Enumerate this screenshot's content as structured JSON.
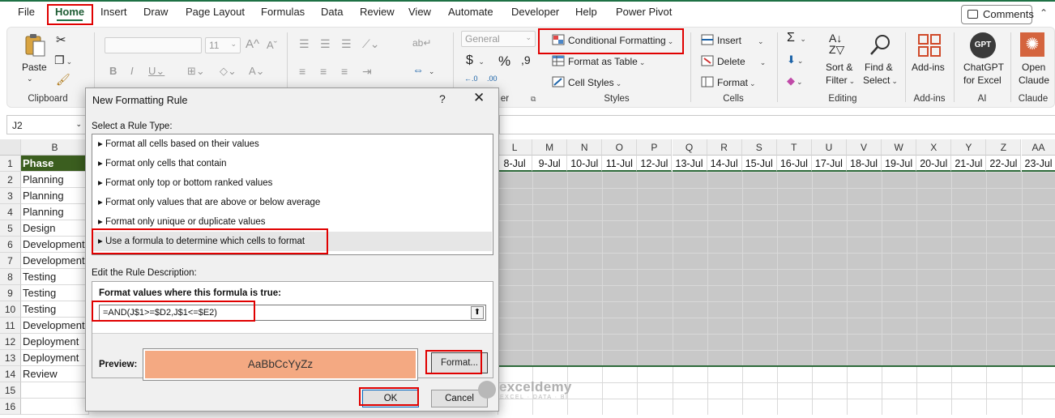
{
  "menu": {
    "tabs": [
      "File",
      "Home",
      "Insert",
      "Draw",
      "Page Layout",
      "Formulas",
      "Data",
      "Review",
      "View",
      "Automate",
      "Developer",
      "Help",
      "Power Pivot"
    ],
    "active": "Home",
    "comments": "Comments"
  },
  "ribbon": {
    "clipboard": {
      "paste": "Paste",
      "label": "Clipboard"
    },
    "font": {
      "size": "11"
    },
    "number": {
      "format": "General",
      "label_tail": "er"
    },
    "styles": {
      "conditional_formatting": "Conditional Formatting",
      "format_as_table": "Format as Table",
      "cell_styles": "Cell Styles",
      "label": "Styles"
    },
    "cells": {
      "insert": "Insert",
      "delete": "Delete",
      "format": "Format",
      "label": "Cells"
    },
    "editing": {
      "sort_filter_1": "Sort &",
      "sort_filter_2": "Filter",
      "find_select_1": "Find &",
      "find_select_2": "Select",
      "label": "Editing"
    },
    "addins": {
      "button": "Add-ins",
      "label": "Add-ins"
    },
    "ai": {
      "button_1": "ChatGPT",
      "button_2": "for Excel",
      "badge": "GPT",
      "label": "AI"
    },
    "claude": {
      "button_1": "Open",
      "button_2": "Claude",
      "label": "Claude"
    },
    "accent": "#1e7145",
    "highlight": "#e00000"
  },
  "namebox": {
    "value": "J2"
  },
  "sheet": {
    "left_col_letter": "B",
    "right_col_letters": [
      "L",
      "M",
      "N",
      "O",
      "P",
      "Q",
      "R",
      "S",
      "T",
      "U",
      "V",
      "W",
      "X",
      "Y",
      "Z",
      "AA"
    ],
    "right_dates": [
      "8-Jul",
      "9-Jul",
      "10-Jul",
      "11-Jul",
      "12-Jul",
      "13-Jul",
      "14-Jul",
      "15-Jul",
      "16-Jul",
      "17-Jul",
      "18-Jul",
      "19-Jul",
      "20-Jul",
      "21-Jul",
      "22-Jul",
      "23-Jul"
    ],
    "row_numbers": [
      "1",
      "2",
      "3",
      "4",
      "5",
      "6",
      "7",
      "8",
      "9",
      "10",
      "11",
      "12",
      "13",
      "14",
      "15",
      "16"
    ],
    "phase_header": "Phase",
    "phases": [
      "Planning",
      "Planning",
      "Planning",
      "Design",
      "Development",
      "Development",
      "Testing",
      "Testing",
      "Testing",
      "Development",
      "Deployment",
      "Deployment",
      "Review"
    ],
    "header_color": "#3b5e1f",
    "shade_color": "#c8c8c8"
  },
  "dialog": {
    "title": "New Formatting Rule",
    "help": "?",
    "close": "✕",
    "select_label": "Select a Rule Type:",
    "rule_types": [
      "Format all cells based on their values",
      "Format only cells that contain",
      "Format only top or bottom ranked values",
      "Format only values that are above or below average",
      "Format only unique or duplicate values",
      "Use a formula to determine which cells to format"
    ],
    "selected_index": 5,
    "edit_label": "Edit the Rule Description:",
    "formula_label": "Format values where this formula is true:",
    "formula": "=AND(J$1>=$D2,J$1<=$E2)",
    "preview_label": "Preview:",
    "preview_text": "AaBbCcYyZz",
    "preview_color": "#f4a982",
    "format_button": "Format...",
    "ok": "OK",
    "cancel": "Cancel"
  },
  "watermark": {
    "name": "exceldemy",
    "tagline": "EXCEL · DATA · BI"
  }
}
